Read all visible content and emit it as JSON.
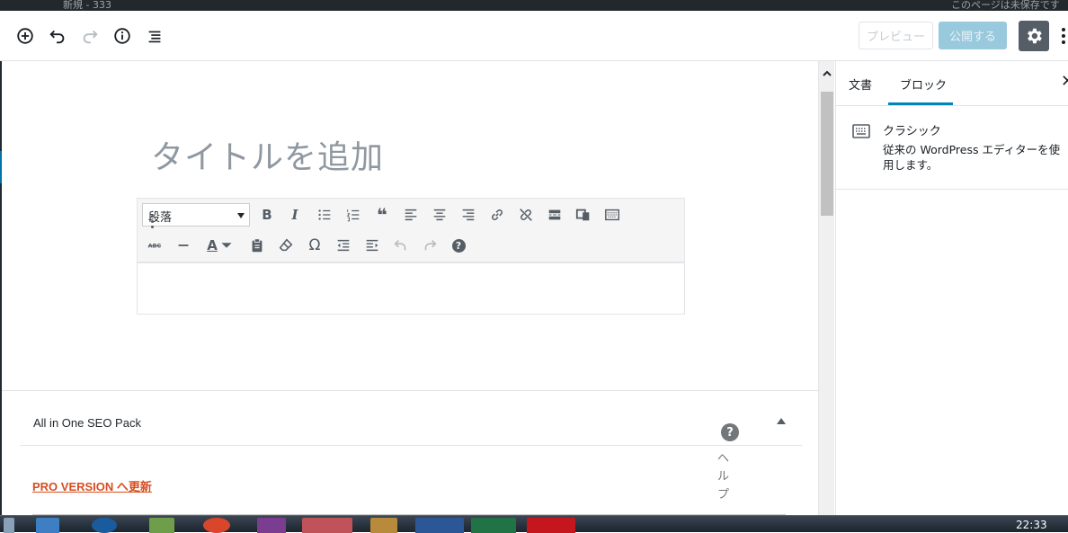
{
  "topbar": {
    "left_text": "新規 - 333",
    "right_text": "このページは未保存です"
  },
  "header": {
    "preview_label": "プレビュー",
    "publish_label": "公開する",
    "icons": [
      "plus-circle-icon",
      "undo-icon",
      "redo-icon",
      "info-icon",
      "list-outline-icon",
      "gear-icon",
      "more-vertical-icon"
    ]
  },
  "editor": {
    "title_placeholder": "タイトルを追加",
    "format_select": "段落",
    "toolbar_row1": [
      "bold-icon",
      "italic-icon",
      "bullet-list-icon",
      "numbered-list-icon",
      "blockquote-icon",
      "align-left-icon",
      "align-center-icon",
      "align-right-icon",
      "link-icon",
      "unlink-icon",
      "read-more-icon",
      "wp-add-media-icon",
      "toolbar-toggle-icon"
    ],
    "toolbar_row2": [
      "strikethrough-icon",
      "horizontal-rule-icon",
      "text-color-icon",
      "paste-text-icon",
      "clear-formatting-icon",
      "special-char-icon",
      "outdent-icon",
      "indent-icon",
      "undo-icon",
      "redo-icon",
      "help-icon"
    ],
    "bold_glyph": "B",
    "italic_glyph": "I",
    "quote_glyph": "❝",
    "text_color_glyph": "A",
    "omega_glyph": "Ω",
    "help_glyph": "?"
  },
  "seo": {
    "title": "All in One SEO Pack",
    "help_glyph": "?",
    "help_text": "ヘルプ",
    "pro_link": "PRO VERSION へ更新"
  },
  "sidebar": {
    "tabs": [
      "文書",
      "ブロック"
    ],
    "active_tab": "ブロック",
    "close_glyph": "✕",
    "block_title": "クラシック",
    "block_description": "従来の WordPress エディターを使用します。"
  },
  "taskbar": {
    "clock": "22:33"
  }
}
